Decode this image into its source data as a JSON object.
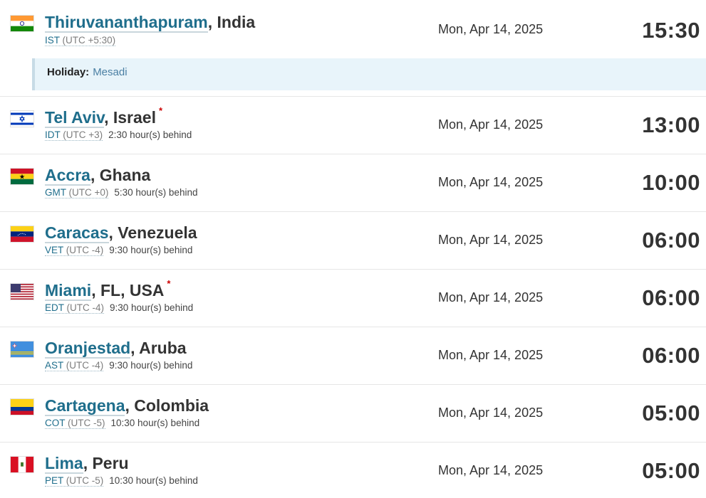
{
  "rows": [
    {
      "city": "Thiruvananthapuram",
      "country": ", India",
      "dst": "",
      "tz": "IST",
      "utc": " (UTC +5:30)",
      "offset": "",
      "date": "Mon, Apr 14, 2025",
      "time": "15:30",
      "flag": "india-flag-icon"
    },
    {
      "city": "Tel Aviv",
      "country": ", Israel",
      "dst": "*",
      "tz": "IDT",
      "utc": " (UTC +3)",
      "offset": "2:30 hour(s) behind",
      "date": "Mon, Apr 14, 2025",
      "time": "13:00",
      "flag": "israel-flag-icon"
    },
    {
      "city": "Accra",
      "country": ", Ghana",
      "dst": "",
      "tz": "GMT",
      "utc": " (UTC +0)",
      "offset": "5:30 hour(s) behind",
      "date": "Mon, Apr 14, 2025",
      "time": "10:00",
      "flag": "ghana-flag-icon"
    },
    {
      "city": "Caracas",
      "country": ", Venezuela",
      "dst": "",
      "tz": "VET",
      "utc": " (UTC -4)",
      "offset": "9:30 hour(s) behind",
      "date": "Mon, Apr 14, 2025",
      "time": "06:00",
      "flag": "venezuela-flag-icon"
    },
    {
      "city": "Miami",
      "country": ", FL, USA",
      "dst": "*",
      "tz": "EDT",
      "utc": " (UTC -4)",
      "offset": "9:30 hour(s) behind",
      "date": "Mon, Apr 14, 2025",
      "time": "06:00",
      "flag": "usa-flag-icon"
    },
    {
      "city": "Oranjestad",
      "country": ", Aruba",
      "dst": "",
      "tz": "AST",
      "utc": " (UTC -4)",
      "offset": "9:30 hour(s) behind",
      "date": "Mon, Apr 14, 2025",
      "time": "06:00",
      "flag": "aruba-flag-icon"
    },
    {
      "city": "Cartagena",
      "country": ", Colombia",
      "dst": "",
      "tz": "COT",
      "utc": " (UTC -5)",
      "offset": "10:30 hour(s) behind",
      "date": "Mon, Apr 14, 2025",
      "time": "05:00",
      "flag": "colombia-flag-icon"
    },
    {
      "city": "Lima",
      "country": ", Peru",
      "dst": "",
      "tz": "PET",
      "utc": " (UTC -5)",
      "offset": "10:30 hour(s) behind",
      "date": "Mon, Apr 14, 2025",
      "time": "05:00",
      "flag": "peru-flag-icon"
    }
  ],
  "holiday": {
    "label": "Holiday:",
    "value": "Mesadi"
  },
  "colors": {
    "link": "#1f6e8c",
    "holiday_bg": "#e8f4fa",
    "dst_marker": "#cc0000"
  }
}
